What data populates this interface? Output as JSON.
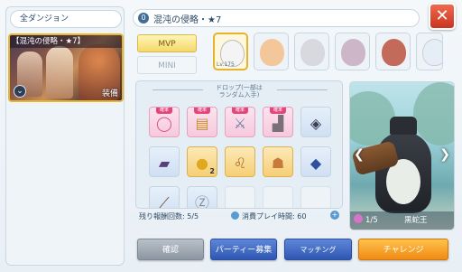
{
  "left_panel": {
    "tab_label": "全ダンジョン",
    "dungeon_title": "【混沌の侵略・★7】",
    "equip_label": "装備"
  },
  "header": {
    "title": "混沌の侵略・★7",
    "close_label": "✕"
  },
  "tiers": {
    "mvp_label": "MVP",
    "mini_label": "MINI"
  },
  "monsters": [
    {
      "lv": "Lv.175",
      "color": "#f4f4f4"
    },
    {
      "lv": "",
      "color": "#f3c79a"
    },
    {
      "lv": "",
      "color": "#d7d9de"
    },
    {
      "lv": "",
      "color": "#cdb6c7"
    },
    {
      "lv": "",
      "color": "#c46a5a"
    },
    {
      "lv": "",
      "color": "#e6eef5"
    }
  ],
  "drops": {
    "label_line1": "ドロップ(一部は",
    "label_line2": "ランダム入手)",
    "rare_tag": "確率",
    "coin_count": "2",
    "items": [
      {
        "icon": "ring-icon",
        "glyph": "◯",
        "style": "rare"
      },
      {
        "icon": "book-icon",
        "glyph": "▤",
        "style": "rare"
      },
      {
        "icon": "sword-icon",
        "glyph": "⚔",
        "style": "rare"
      },
      {
        "icon": "boots-icon",
        "glyph": "▟",
        "style": "rare"
      },
      {
        "icon": "shield-icon",
        "glyph": "◈",
        "style": "blue"
      },
      {
        "icon": "card-icon",
        "glyph": "▰",
        "style": "blue"
      },
      {
        "icon": "coin-icon",
        "glyph": "●",
        "style": "gold"
      },
      {
        "icon": "lion-icon",
        "glyph": "♌",
        "style": "gold"
      },
      {
        "icon": "fox-icon",
        "glyph": "☗",
        "style": "gold"
      },
      {
        "icon": "hair-icon",
        "glyph": "◆",
        "style": "blue"
      },
      {
        "icon": "wand-icon",
        "glyph": "⟋",
        "style": "blue"
      },
      {
        "icon": "z-coin-icon",
        "glyph": "Ⓩ",
        "style": "blue"
      }
    ]
  },
  "stats": {
    "remaining": "残り報酬回数: 5/5",
    "time": "消費プレイ時間: 60"
  },
  "boss": {
    "progress": "1/5",
    "name": "黒蛇王"
  },
  "buttons": {
    "gray": "確認",
    "party": "パーティー募集",
    "matching": "マッチング",
    "challenge": "チャレンジ"
  }
}
